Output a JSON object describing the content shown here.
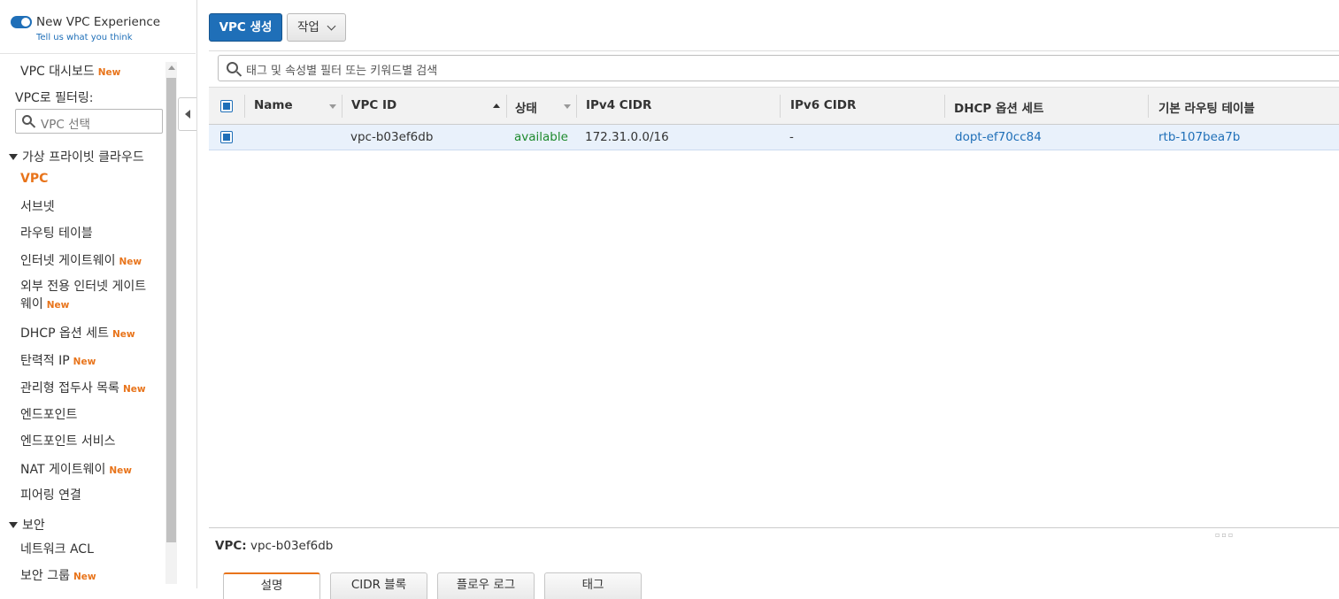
{
  "sidebar": {
    "experience_title": "New VPC Experience",
    "experience_sub": "Tell us what you think",
    "dashboard": "VPC 대시보드",
    "new_badge": "New",
    "filter_label": "VPC로 필터링:",
    "filter_placeholder": "VPC 선택",
    "section_vpc": "가상 프라이빗 클라우드",
    "section_security": "보안",
    "items": [
      {
        "label": "VPC",
        "new": false
      },
      {
        "label": "서브넷",
        "new": false
      },
      {
        "label": "라우팅 테이블",
        "new": false
      },
      {
        "label": "인터넷 게이트웨이",
        "new": true
      },
      {
        "label": "외부 전용 인터넷 게이트",
        "label2": "웨이",
        "new": true
      },
      {
        "label": "DHCP 옵션 세트",
        "new": true
      },
      {
        "label": "탄력적 IP",
        "new": true
      },
      {
        "label": "관리형 접두사 목록",
        "new": true
      },
      {
        "label": "엔드포인트",
        "new": false
      },
      {
        "label": "엔드포인트 서비스",
        "new": false
      },
      {
        "label": "NAT 게이트웨이",
        "new": true
      },
      {
        "label": "피어링 연결",
        "new": false
      }
    ],
    "security_items": [
      {
        "label": "네트워크 ACL",
        "new": false
      },
      {
        "label": "보안 그룹",
        "new": true
      }
    ]
  },
  "toolbar": {
    "create_label": "VPC 생성",
    "actions_label": "작업"
  },
  "search": {
    "placeholder": "태그 및 속성별 필터 또는 키워드별 검색"
  },
  "table": {
    "columns": [
      "Name",
      "VPC ID",
      "상태",
      "IPv4 CIDR",
      "IPv6 CIDR",
      "DHCP 옵션 세트",
      "기본 라우팅 테이블"
    ],
    "rows": [
      {
        "name": "",
        "vpc_id": "vpc-b03ef6db",
        "state": "available",
        "ipv4": "172.31.0.0/16",
        "ipv6": "-",
        "dhcp": "dopt-ef70cc84",
        "route_table": "rtb-107bea7b"
      }
    ]
  },
  "detail": {
    "label": "VPC:",
    "value": "vpc-b03ef6db",
    "tabs": [
      "설명",
      "CIDR 블록",
      "플로우 로그",
      "태그"
    ]
  },
  "colors": {
    "accent": "#1f6fb8",
    "orange": "#e8741b",
    "available": "#1e8a2e"
  }
}
